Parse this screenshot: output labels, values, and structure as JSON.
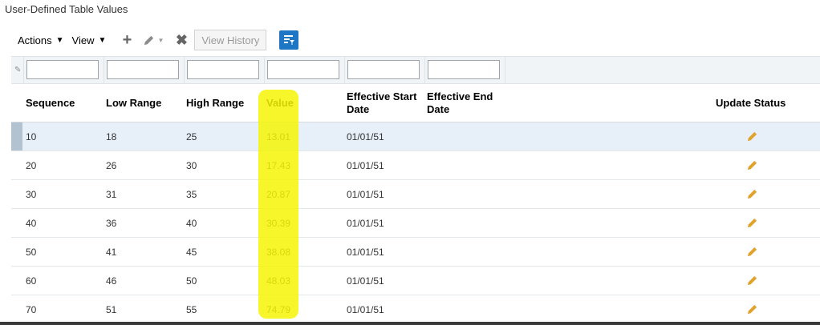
{
  "page": {
    "title": "User-Defined Table Values"
  },
  "toolbar": {
    "actions_label": "Actions",
    "view_label": "View",
    "view_history_label": "View History",
    "add_icon": "plus-icon",
    "edit_icon": "pencil-icon",
    "delete_icon": "close-icon",
    "filter_icon": "query-by-example-icon",
    "accent_color": "#1d77c4"
  },
  "columns": {
    "sequence": "Sequence",
    "low_range": "Low Range",
    "high_range": "High Range",
    "value": "Value",
    "effective_start_date": "Effective Start Date",
    "effective_end_date": "Effective End Date",
    "update_status": "Update Status"
  },
  "rows": [
    {
      "sequence": "10",
      "low_range": "18",
      "high_range": "25",
      "value": "13.01",
      "effective_start_date": "01/01/51",
      "effective_end_date": "",
      "selected": true
    },
    {
      "sequence": "20",
      "low_range": "26",
      "high_range": "30",
      "value": "17.43",
      "effective_start_date": "01/01/51",
      "effective_end_date": ""
    },
    {
      "sequence": "30",
      "low_range": "31",
      "high_range": "35",
      "value": "20.87",
      "effective_start_date": "01/01/51",
      "effective_end_date": ""
    },
    {
      "sequence": "40",
      "low_range": "36",
      "high_range": "40",
      "value": "30.39",
      "effective_start_date": "01/01/51",
      "effective_end_date": ""
    },
    {
      "sequence": "50",
      "low_range": "41",
      "high_range": "45",
      "value": "38.08",
      "effective_start_date": "01/01/51",
      "effective_end_date": ""
    },
    {
      "sequence": "60",
      "low_range": "46",
      "high_range": "50",
      "value": "48.03",
      "effective_start_date": "01/01/51",
      "effective_end_date": ""
    },
    {
      "sequence": "70",
      "low_range": "51",
      "high_range": "55",
      "value": "74.79",
      "effective_start_date": "01/01/51",
      "effective_end_date": ""
    }
  ],
  "colors": {
    "highlight": "#f5f505",
    "selected_row": "#e7f0f9",
    "pencil": "#e0a32d"
  }
}
